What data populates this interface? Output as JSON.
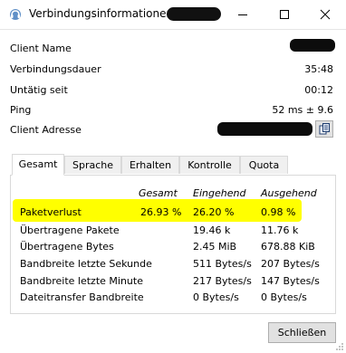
{
  "window": {
    "title": "Verbindungsinformationen -",
    "minimize_icon": "minimize-icon",
    "maximize_icon": "maximize-icon",
    "close_icon": "close-icon"
  },
  "info": {
    "client_name_label": "Client Name",
    "duration_label": "Verbindungsdauer",
    "duration_value": "35:48",
    "idle_label": "Untätig seit",
    "idle_value": "00:12",
    "ping_label": "Ping",
    "ping_value": "52 ms ± 9.6",
    "address_label": "Client Adresse"
  },
  "tabs": [
    {
      "label": "Gesamt",
      "active": true
    },
    {
      "label": "Sprache",
      "active": false
    },
    {
      "label": "Erhalten",
      "active": false
    },
    {
      "label": "Kontrolle",
      "active": false
    },
    {
      "label": "Quota",
      "active": false
    }
  ],
  "stats": {
    "headers": [
      "Gesamt",
      "Eingehend",
      "Ausgehend"
    ],
    "rows": [
      {
        "label": "Paketverlust",
        "values": [
          "26.93 %",
          "26.20 %",
          "0.98 %"
        ],
        "highlighted": true
      },
      {
        "label": "Übertragene Pakete",
        "values": [
          "",
          "19.46 k",
          "11.76 k"
        ]
      },
      {
        "label": "Übertragene Bytes",
        "values": [
          "",
          "2.45 MiB",
          "678.88 KiB"
        ]
      },
      {
        "label": "Bandbreite letzte Sekunde",
        "values": [
          "",
          "511 Bytes/s",
          "207 Bytes/s"
        ]
      },
      {
        "label": "Bandbreite letzte Minute",
        "values": [
          "",
          "217 Bytes/s",
          "147 Bytes/s"
        ]
      },
      {
        "label": "Dateitransfer Bandbreite",
        "values": [
          "",
          "0 Bytes/s",
          "0 Bytes/s"
        ]
      }
    ],
    "highlight_color": "#ffff00"
  },
  "footer": {
    "close_label": "Schließen"
  }
}
